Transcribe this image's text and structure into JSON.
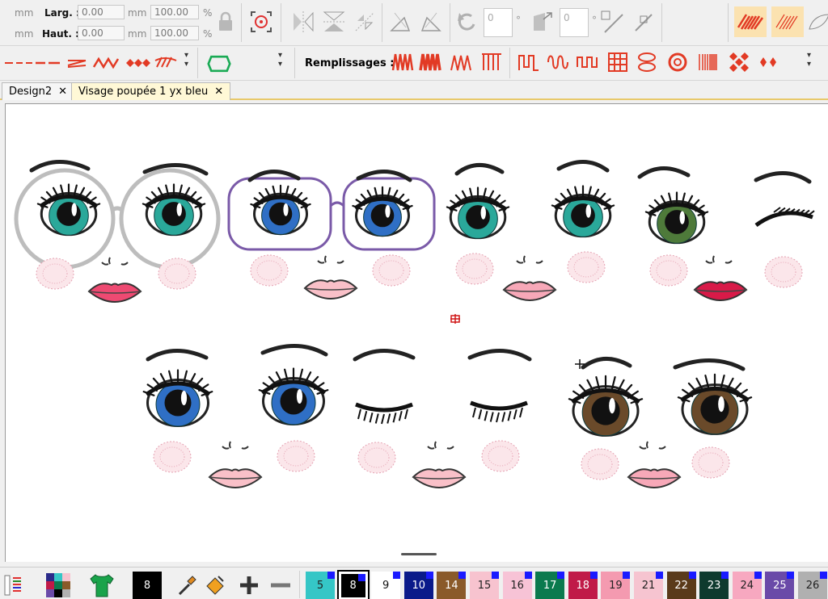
{
  "toolbar": {
    "unit_mm": "mm",
    "unit_percent": "%",
    "width_label": "Larg. :",
    "height_label": "Haut. :",
    "width_value": "0.00",
    "height_value": "0.00",
    "width_scale": "100.00",
    "height_scale": "100.00",
    "rotate_value": "0",
    "slant_value": "0",
    "degree_symbol": "°"
  },
  "toolbar2": {
    "fills_label": "Remplissages :"
  },
  "tabs": [
    {
      "label": "Design2"
    },
    {
      "label": "Visage poupée 1 yx bleu"
    }
  ],
  "tab_close_glyph": "✕",
  "palette": {
    "current_color": "8",
    "swatches": [
      {
        "label": "5",
        "color": "#35c6c6"
      },
      {
        "label": "8",
        "color": "#000000"
      },
      {
        "label": "9",
        "color": "#ffffff"
      },
      {
        "label": "10",
        "color": "#0a1a8a"
      },
      {
        "label": "14",
        "color": "#8a5a2a"
      },
      {
        "label": "15",
        "color": "#f7c3cf"
      },
      {
        "label": "16",
        "color": "#f7c3d6"
      },
      {
        "label": "17",
        "color": "#0b7a4e"
      },
      {
        "label": "18",
        "color": "#c01a48"
      },
      {
        "label": "19",
        "color": "#f49ab0"
      },
      {
        "label": "21",
        "color": "#f6c4d0"
      },
      {
        "label": "22",
        "color": "#5a3a1a"
      },
      {
        "label": "23",
        "color": "#0e3a2e"
      },
      {
        "label": "24",
        "color": "#f7a8c0"
      },
      {
        "label": "25",
        "color": "#6a4aa8"
      },
      {
        "label": "26",
        "color": "#b0b0b0"
      }
    ]
  }
}
